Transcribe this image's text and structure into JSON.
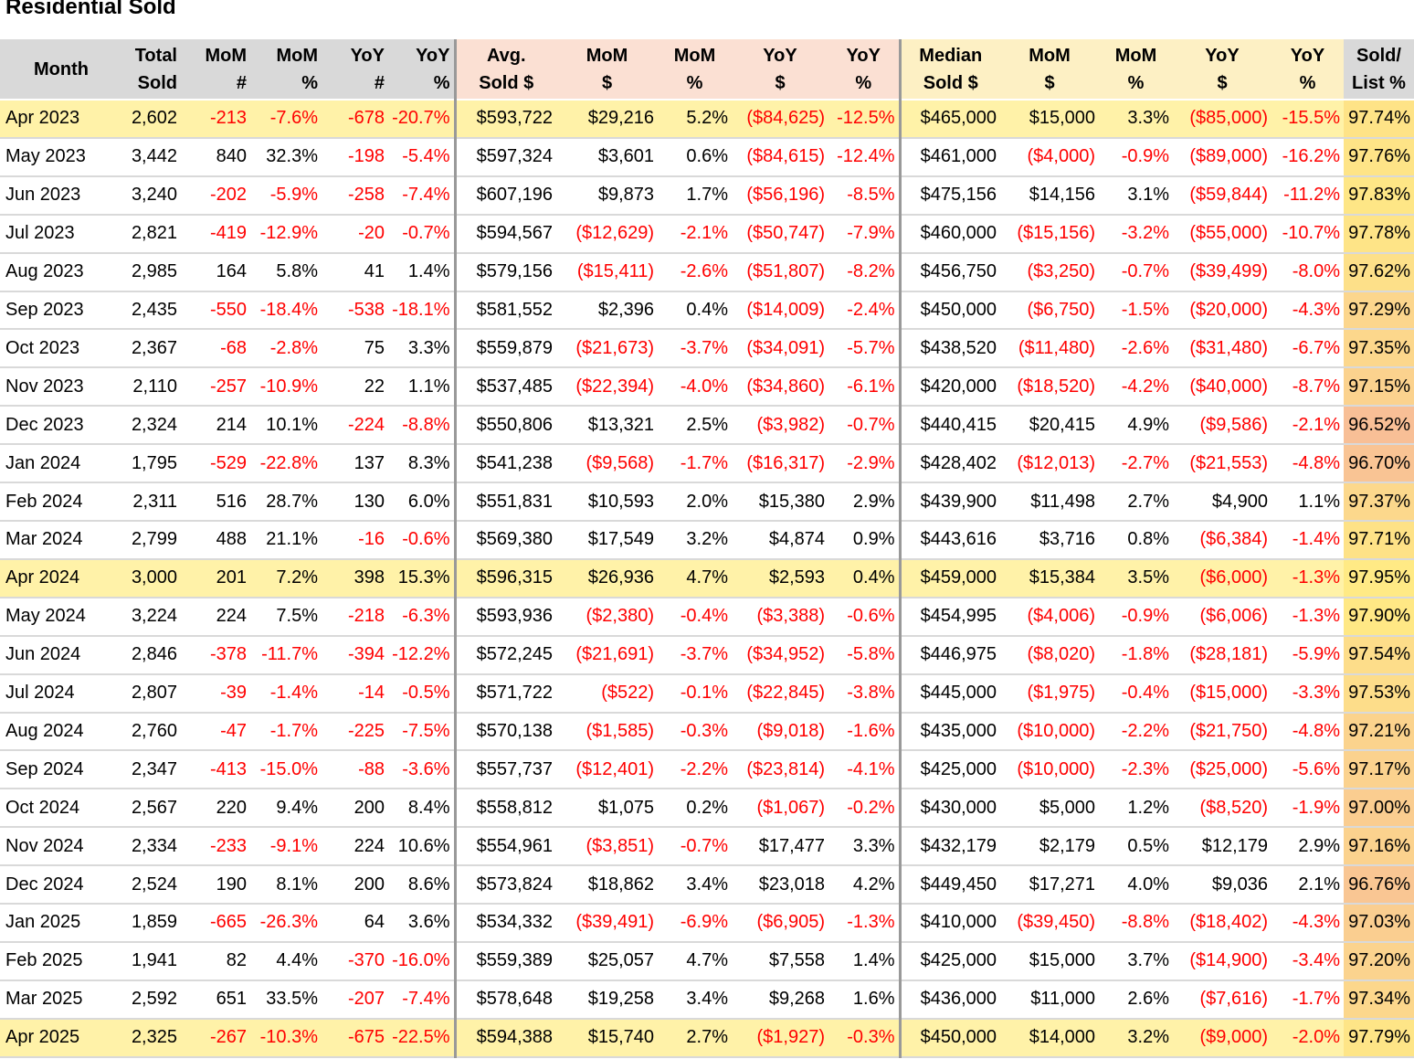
{
  "title": "Residential Sold",
  "headers": [
    [
      "Month"
    ],
    [
      "Total",
      "Sold"
    ],
    [
      "MoM",
      "#"
    ],
    [
      "MoM",
      "%"
    ],
    [
      "YoY",
      "#"
    ],
    [
      "YoY",
      "%"
    ],
    [
      "Avg.",
      "Sold $"
    ],
    [
      "MoM",
      "$"
    ],
    [
      "MoM",
      "%"
    ],
    [
      "YoY",
      "$"
    ],
    [
      "YoY",
      "%"
    ],
    [
      "Median",
      "Sold $"
    ],
    [
      "MoM",
      "$"
    ],
    [
      "MoM",
      "%"
    ],
    [
      "YoY",
      "$"
    ],
    [
      "YoY",
      "%"
    ],
    [
      "Sold/",
      "List %"
    ]
  ],
  "highlight_rows": [
    0,
    12,
    24
  ],
  "rows": [
    [
      "Apr 2023",
      "2,602",
      "-213",
      "-7.6%",
      "-678",
      "-20.7%",
      "$593,722",
      "$29,216",
      "5.2%",
      "($84,625)",
      "-12.5%",
      "$465,000",
      "$15,000",
      "3.3%",
      "($85,000)",
      "-15.5%",
      "97.74%"
    ],
    [
      "May 2023",
      "3,442",
      "840",
      "32.3%",
      "-198",
      "-5.4%",
      "$597,324",
      "$3,601",
      "0.6%",
      "($84,615)",
      "-12.4%",
      "$461,000",
      "($4,000)",
      "-0.9%",
      "($89,000)",
      "-16.2%",
      "97.76%"
    ],
    [
      "Jun 2023",
      "3,240",
      "-202",
      "-5.9%",
      "-258",
      "-7.4%",
      "$607,196",
      "$9,873",
      "1.7%",
      "($56,196)",
      "-8.5%",
      "$475,156",
      "$14,156",
      "3.1%",
      "($59,844)",
      "-11.2%",
      "97.83%"
    ],
    [
      "Jul 2023",
      "2,821",
      "-419",
      "-12.9%",
      "-20",
      "-0.7%",
      "$594,567",
      "($12,629)",
      "-2.1%",
      "($50,747)",
      "-7.9%",
      "$460,000",
      "($15,156)",
      "-3.2%",
      "($55,000)",
      "-10.7%",
      "97.78%"
    ],
    [
      "Aug 2023",
      "2,985",
      "164",
      "5.8%",
      "41",
      "1.4%",
      "$579,156",
      "($15,411)",
      "-2.6%",
      "($51,807)",
      "-8.2%",
      "$456,750",
      "($3,250)",
      "-0.7%",
      "($39,499)",
      "-8.0%",
      "97.62%"
    ],
    [
      "Sep 2023",
      "2,435",
      "-550",
      "-18.4%",
      "-538",
      "-18.1%",
      "$581,552",
      "$2,396",
      "0.4%",
      "($14,009)",
      "-2.4%",
      "$450,000",
      "($6,750)",
      "-1.5%",
      "($20,000)",
      "-4.3%",
      "97.29%"
    ],
    [
      "Oct 2023",
      "2,367",
      "-68",
      "-2.8%",
      "75",
      "3.3%",
      "$559,879",
      "($21,673)",
      "-3.7%",
      "($34,091)",
      "-5.7%",
      "$438,520",
      "($11,480)",
      "-2.6%",
      "($31,480)",
      "-6.7%",
      "97.35%"
    ],
    [
      "Nov 2023",
      "2,110",
      "-257",
      "-10.9%",
      "22",
      "1.1%",
      "$537,485",
      "($22,394)",
      "-4.0%",
      "($34,860)",
      "-6.1%",
      "$420,000",
      "($18,520)",
      "-4.2%",
      "($40,000)",
      "-8.7%",
      "97.15%"
    ],
    [
      "Dec 2023",
      "2,324",
      "214",
      "10.1%",
      "-224",
      "-8.8%",
      "$550,806",
      "$13,321",
      "2.5%",
      "($3,982)",
      "-0.7%",
      "$440,415",
      "$20,415",
      "4.9%",
      "($9,586)",
      "-2.1%",
      "96.52%"
    ],
    [
      "Jan 2024",
      "1,795",
      "-529",
      "-22.8%",
      "137",
      "8.3%",
      "$541,238",
      "($9,568)",
      "-1.7%",
      "($16,317)",
      "-2.9%",
      "$428,402",
      "($12,013)",
      "-2.7%",
      "($21,553)",
      "-4.8%",
      "96.70%"
    ],
    [
      "Feb 2024",
      "2,311",
      "516",
      "28.7%",
      "130",
      "6.0%",
      "$551,831",
      "$10,593",
      "2.0%",
      "$15,380",
      "2.9%",
      "$439,900",
      "$11,498",
      "2.7%",
      "$4,900",
      "1.1%",
      "97.37%"
    ],
    [
      "Mar 2024",
      "2,799",
      "488",
      "21.1%",
      "-16",
      "-0.6%",
      "$569,380",
      "$17,549",
      "3.2%",
      "$4,874",
      "0.9%",
      "$443,616",
      "$3,716",
      "0.8%",
      "($6,384)",
      "-1.4%",
      "97.71%"
    ],
    [
      "Apr 2024",
      "3,000",
      "201",
      "7.2%",
      "398",
      "15.3%",
      "$596,315",
      "$26,936",
      "4.7%",
      "$2,593",
      "0.4%",
      "$459,000",
      "$15,384",
      "3.5%",
      "($6,000)",
      "-1.3%",
      "97.95%"
    ],
    [
      "May 2024",
      "3,224",
      "224",
      "7.5%",
      "-218",
      "-6.3%",
      "$593,936",
      "($2,380)",
      "-0.4%",
      "($3,388)",
      "-0.6%",
      "$454,995",
      "($4,006)",
      "-0.9%",
      "($6,006)",
      "-1.3%",
      "97.90%"
    ],
    [
      "Jun 2024",
      "2,846",
      "-378",
      "-11.7%",
      "-394",
      "-12.2%",
      "$572,245",
      "($21,691)",
      "-3.7%",
      "($34,952)",
      "-5.8%",
      "$446,975",
      "($8,020)",
      "-1.8%",
      "($28,181)",
      "-5.9%",
      "97.54%"
    ],
    [
      "Jul 2024",
      "2,807",
      "-39",
      "-1.4%",
      "-14",
      "-0.5%",
      "$571,722",
      "($522)",
      "-0.1%",
      "($22,845)",
      "-3.8%",
      "$445,000",
      "($1,975)",
      "-0.4%",
      "($15,000)",
      "-3.3%",
      "97.53%"
    ],
    [
      "Aug 2024",
      "2,760",
      "-47",
      "-1.7%",
      "-225",
      "-7.5%",
      "$570,138",
      "($1,585)",
      "-0.3%",
      "($9,018)",
      "-1.6%",
      "$435,000",
      "($10,000)",
      "-2.2%",
      "($21,750)",
      "-4.8%",
      "97.21%"
    ],
    [
      "Sep 2024",
      "2,347",
      "-413",
      "-15.0%",
      "-88",
      "-3.6%",
      "$557,737",
      "($12,401)",
      "-2.2%",
      "($23,814)",
      "-4.1%",
      "$425,000",
      "($10,000)",
      "-2.3%",
      "($25,000)",
      "-5.6%",
      "97.17%"
    ],
    [
      "Oct 2024",
      "2,567",
      "220",
      "9.4%",
      "200",
      "8.4%",
      "$558,812",
      "$1,075",
      "0.2%",
      "($1,067)",
      "-0.2%",
      "$430,000",
      "$5,000",
      "1.2%",
      "($8,520)",
      "-1.9%",
      "97.00%"
    ],
    [
      "Nov 2024",
      "2,334",
      "-233",
      "-9.1%",
      "224",
      "10.6%",
      "$554,961",
      "($3,851)",
      "-0.7%",
      "$17,477",
      "3.3%",
      "$432,179",
      "$2,179",
      "0.5%",
      "$12,179",
      "2.9%",
      "97.16%"
    ],
    [
      "Dec 2024",
      "2,524",
      "190",
      "8.1%",
      "200",
      "8.6%",
      "$573,824",
      "$18,862",
      "3.4%",
      "$23,018",
      "4.2%",
      "$449,450",
      "$17,271",
      "4.0%",
      "$9,036",
      "2.1%",
      "96.76%"
    ],
    [
      "Jan 2025",
      "1,859",
      "-665",
      "-26.3%",
      "64",
      "3.6%",
      "$534,332",
      "($39,491)",
      "-6.9%",
      "($6,905)",
      "-1.3%",
      "$410,000",
      "($39,450)",
      "-8.8%",
      "($18,402)",
      "-4.3%",
      "97.03%"
    ],
    [
      "Feb 2025",
      "1,941",
      "82",
      "4.4%",
      "-370",
      "-16.0%",
      "$559,389",
      "$25,057",
      "4.7%",
      "$7,558",
      "1.4%",
      "$425,000",
      "$15,000",
      "3.7%",
      "($14,900)",
      "-3.4%",
      "97.20%"
    ],
    [
      "Mar 2025",
      "2,592",
      "651",
      "33.5%",
      "-207",
      "-7.4%",
      "$578,648",
      "$19,258",
      "3.4%",
      "$9,268",
      "1.6%",
      "$436,000",
      "$11,000",
      "2.6%",
      "($7,616)",
      "-1.7%",
      "97.34%"
    ],
    [
      "Apr 2025",
      "2,325",
      "-267",
      "-10.3%",
      "-675",
      "-22.5%",
      "$594,388",
      "$15,740",
      "2.7%",
      "($1,927)",
      "-0.3%",
      "$450,000",
      "$14,000",
      "3.2%",
      "($9,000)",
      "-2.0%",
      "97.79%"
    ]
  ]
}
